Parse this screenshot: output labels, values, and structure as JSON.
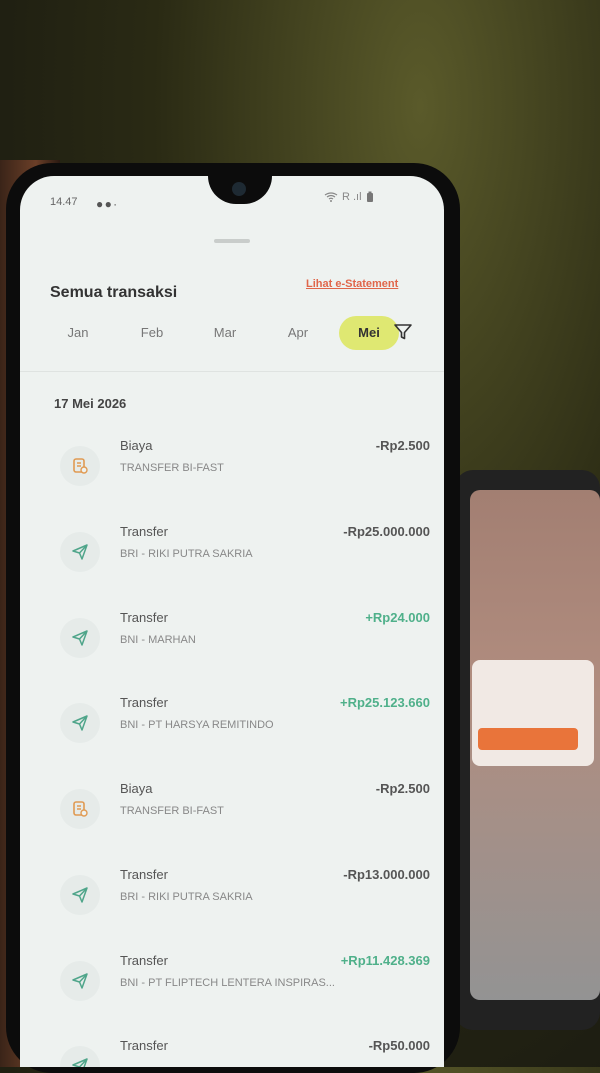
{
  "status_bar": {
    "time": "14.47",
    "dots": "● ● ·",
    "right": "R .ıl"
  },
  "header": {
    "title": "Semua transaksi",
    "statement_link": "Lihat e-Statement"
  },
  "months": [
    {
      "label": "Jan",
      "active": false
    },
    {
      "label": "Feb",
      "active": false
    },
    {
      "label": "Mar",
      "active": false
    },
    {
      "label": "Apr",
      "active": false
    },
    {
      "label": "Mei",
      "active": true
    }
  ],
  "date_group": "17 Mei 2026",
  "transactions": [
    {
      "icon": "fee-icon",
      "type": "Biaya",
      "desc": "TRANSFER BI-FAST",
      "amount": "-Rp2.500",
      "direction": "out"
    },
    {
      "icon": "send-icon",
      "type": "Transfer",
      "desc": "BRI - RIKI PUTRA SAKRIA",
      "amount": "-Rp25.000.000",
      "direction": "out"
    },
    {
      "icon": "send-icon",
      "type": "Transfer",
      "desc": "BNI - MARHAN",
      "amount": "+Rp24.000",
      "direction": "in"
    },
    {
      "icon": "send-icon",
      "type": "Transfer",
      "desc": "BNI - PT HARSYA REMITINDO",
      "amount": "+Rp25.123.660",
      "direction": "in"
    },
    {
      "icon": "fee-icon",
      "type": "Biaya",
      "desc": "TRANSFER BI-FAST",
      "amount": "-Rp2.500",
      "direction": "out"
    },
    {
      "icon": "send-icon",
      "type": "Transfer",
      "desc": "BRI - RIKI PUTRA SAKRIA",
      "amount": "-Rp13.000.000",
      "direction": "out"
    },
    {
      "icon": "send-icon",
      "type": "Transfer",
      "desc": "BNI - PT FLIPTECH LENTERA INSPIRAS...",
      "amount": "+Rp11.428.369",
      "direction": "in"
    },
    {
      "icon": "send-icon",
      "type": "Transfer",
      "desc": "",
      "amount": "-Rp50.000",
      "direction": "out"
    }
  ],
  "colors": {
    "accent_month": "#dfe872",
    "link": "#e0664a",
    "positive": "#4fb08a",
    "fee_icon": "#e09a52",
    "send_icon": "#4fa58a"
  }
}
